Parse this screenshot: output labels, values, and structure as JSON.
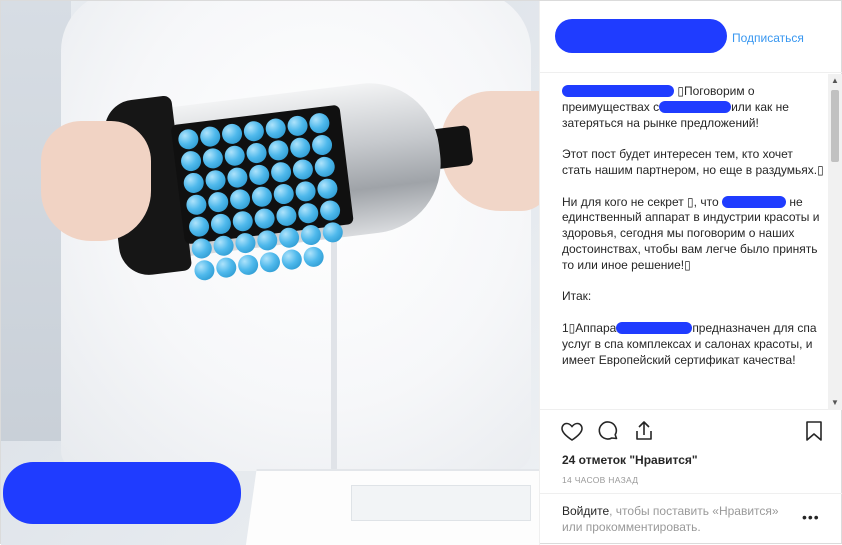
{
  "header": {
    "follow_label": "Подписаться"
  },
  "caption": {
    "p1_part1": "▯Поговорим о преимуществах с",
    "p1_part2": "или как не затеряться на рынке предложений!",
    "p2": "Этот пост  будет интересен тем, кто хочет стать нашим партнером, но еще в раздумьях.▯",
    "p3_part1": "Ни для кого не секрет ▯, что",
    "p3_part2": "не единственный аппарат в индустрии красоты и здоровья, сегодня мы поговорим  о наших достоинствах, чтобы вам легче было принять то или иное решение!▯",
    "p4": "Итак:",
    "p5_part1": "1▯Аппара",
    "p5_part2": "предназначен для спа услуг в спа комплексах и салонах красоты, и имеет Европейский сертификат качества!"
  },
  "stats": {
    "likes": "24 отметок \"Нравится\"",
    "time": "14 часов назад"
  },
  "comment": {
    "login_label": "Войдите",
    "rest": ", чтобы поставить «Нравится» или прокомментировать.",
    "more": "•••"
  },
  "icons": {
    "like": "heart-icon",
    "comment": "comment-icon",
    "share": "share-icon",
    "save": "bookmark-icon"
  },
  "colors": {
    "accent": "#3897f0",
    "redaction": "#1f3cff",
    "balls": "#4fb9ec"
  }
}
